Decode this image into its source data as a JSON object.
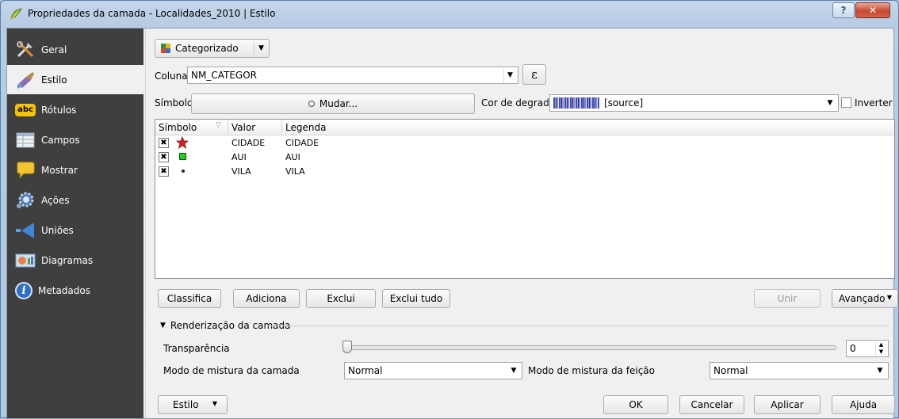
{
  "window": {
    "title": "Propriedades da camada - Localidades_2010 | Estilo",
    "help_glyph": "?",
    "close_glyph": "✕"
  },
  "sidebar": {
    "items": [
      {
        "label": "Geral",
        "icon": "tools-icon"
      },
      {
        "label": "Estilo",
        "icon": "paintbrush-icon"
      },
      {
        "label": "Rótulos",
        "icon": "abc-label-icon",
        "icon_text": "abc"
      },
      {
        "label": "Campos",
        "icon": "table-icon"
      },
      {
        "label": "Mostrar",
        "icon": "speech-bubble-icon"
      },
      {
        "label": "Ações",
        "icon": "gear-icon"
      },
      {
        "label": "Uniões",
        "icon": "join-icon"
      },
      {
        "label": "Diagramas",
        "icon": "diagram-icon"
      },
      {
        "label": "Metadados",
        "icon": "info-icon",
        "icon_text": "i"
      }
    ],
    "active_index": 1
  },
  "renderer": {
    "type": "Categorizado"
  },
  "column": {
    "label": "Coluna",
    "value": "NM_CATEGOR",
    "expr_glyph": "ε"
  },
  "symbol": {
    "label": "Símbolo",
    "change_button": "Mudar..."
  },
  "ramp": {
    "label": "Cor de degradê",
    "value": "[source]",
    "invert_label": "Inverter"
  },
  "table": {
    "headers": [
      "Símbolo",
      "Valor",
      "Legenda"
    ],
    "rows": [
      {
        "checked": true,
        "symbol": "red-star-icon",
        "value": "CIDADE",
        "legend": "CIDADE"
      },
      {
        "checked": true,
        "symbol": "green-square-icon",
        "value": "AUI",
        "legend": "AUI"
      },
      {
        "checked": true,
        "symbol": "small-dot-icon",
        "value": "VILA",
        "legend": "VILA"
      }
    ],
    "check_glyph": "✖"
  },
  "actions": {
    "classify": "Classifica",
    "add": "Adiciona",
    "delete": "Exclui",
    "delete_all": "Exclui tudo",
    "merge": "Unir",
    "advanced": "Avançado"
  },
  "layer_rendering": {
    "title": "Renderização da camada",
    "transparency_label": "Transparência",
    "transparency_value": "0",
    "layer_blend_label": "Modo de mistura da camada",
    "layer_blend_value": "Normal",
    "feature_blend_label": "Modo de mistura da feição",
    "feature_blend_value": "Normal"
  },
  "footer": {
    "style": "Estilo",
    "ok": "OK",
    "cancel": "Cancelar",
    "apply": "Aplicar",
    "help": "Ajuda"
  },
  "colors": {
    "sidebar_bg": "#3f3f3f",
    "star_red": "#d42020",
    "square_green": "#22cc22"
  }
}
